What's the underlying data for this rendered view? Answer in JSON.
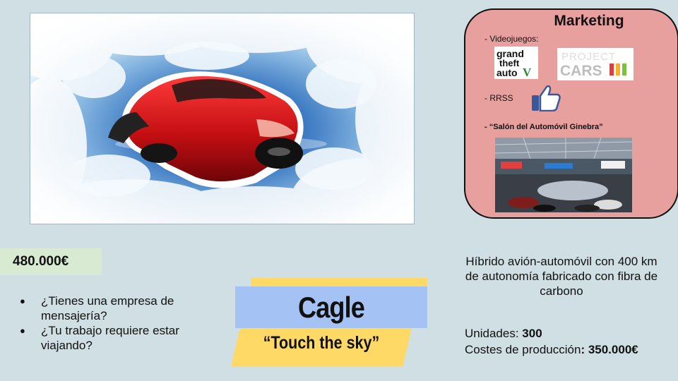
{
  "slide": {
    "background_color": "#d0dfe3"
  },
  "hero": {
    "image": "flying-red-car-in-clouds"
  },
  "marketing": {
    "title": "Marketing",
    "videojuegos_label": "- Videojuegos:",
    "gta_logo": {
      "line1": "grand",
      "line2": "theft",
      "line3": "auto",
      "numeral": "V"
    },
    "project_cars_logo": {
      "line1": "PROJECT",
      "line2": "CARS"
    },
    "rrss_label": "- RRSS",
    "rrss_icon": "thumbs-up-icon",
    "salon_label": "- “Salón del Automóvil Ginebra”",
    "background_color": "#e8a09f"
  },
  "price": {
    "value": "480.000€",
    "background_color": "#d9ead3"
  },
  "bullets": [
    "¿Tienes una empresa de mensajería?",
    "¿Tu trabajo requiere estar viajando?"
  ],
  "banner": {
    "name": "Cagle",
    "slogan": "“Touch the sky”",
    "blue_color": "#a4c2f4",
    "yellow_color": "#ffd966"
  },
  "description": {
    "text": "Híbrido avión-automóvil con 400 km de autonomía fabricado con fibra de carbono"
  },
  "stats": {
    "unidades_label": "Unidades: ",
    "unidades_value": "300",
    "costes_label": "Costes de producción",
    "costes_value": ": 350.000€"
  }
}
